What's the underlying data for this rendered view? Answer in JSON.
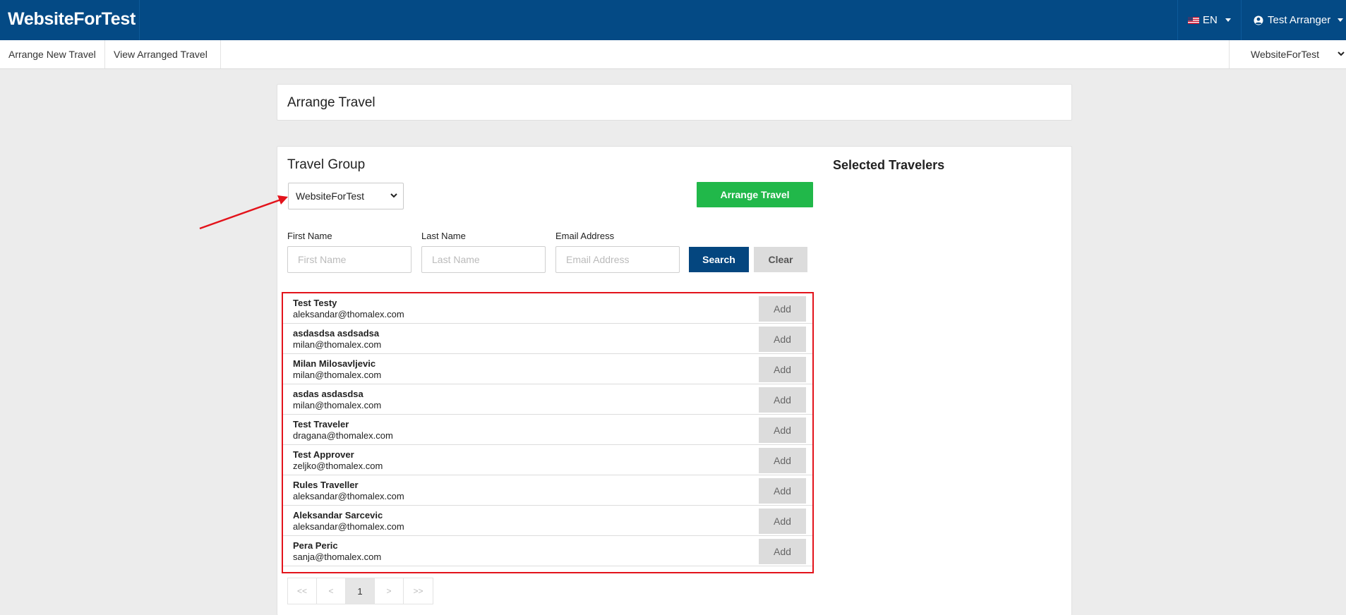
{
  "header": {
    "brand": "WebsiteForTest",
    "language": "EN",
    "user": "Test Arranger",
    "colors": {
      "header_bg": "#044a85"
    }
  },
  "subnav": {
    "items": [
      "Arrange New Travel",
      "View Arranged Travel"
    ],
    "org_selector": "WebsiteForTest"
  },
  "page": {
    "title": "Arrange Travel"
  },
  "travel_group": {
    "heading": "Travel Group",
    "selected_group": "WebsiteForTest",
    "arrange_button": "Arrange Travel"
  },
  "search": {
    "first_name_label": "First Name",
    "first_name_placeholder": "First Name",
    "last_name_label": "Last Name",
    "last_name_placeholder": "Last Name",
    "email_label": "Email Address",
    "email_placeholder": "Email Address",
    "search_button": "Search",
    "clear_button": "Clear"
  },
  "selected_travelers": {
    "heading": "Selected Travelers"
  },
  "travelers": [
    {
      "name": "Test Testy",
      "email": "aleksandar@thomalex.com",
      "action": "Add"
    },
    {
      "name": "asdasdsa asdsadsa",
      "email": "milan@thomalex.com",
      "action": "Add"
    },
    {
      "name": "Milan Milosavljevic",
      "email": "milan@thomalex.com",
      "action": "Add"
    },
    {
      "name": "asdas asdasdsa",
      "email": "milan@thomalex.com",
      "action": "Add"
    },
    {
      "name": "Test Traveler",
      "email": "dragana@thomalex.com",
      "action": "Add"
    },
    {
      "name": "Test Approver",
      "email": "zeljko@thomalex.com",
      "action": "Add"
    },
    {
      "name": "Rules Traveller",
      "email": "aleksandar@thomalex.com",
      "action": "Add"
    },
    {
      "name": "Aleksandar Sarcevic",
      "email": "aleksandar@thomalex.com",
      "action": "Add"
    },
    {
      "name": "Pera Peric",
      "email": "sanja@thomalex.com",
      "action": "Add"
    }
  ],
  "pagination": {
    "first": "<<",
    "prev": "<",
    "current": "1",
    "next": ">",
    "last": ">>"
  }
}
